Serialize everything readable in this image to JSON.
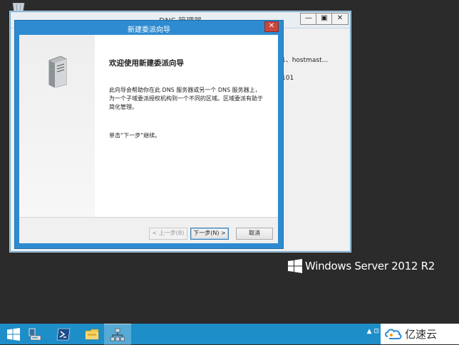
{
  "background_window": {
    "title": "DNS 管理器",
    "controls": [
      "—",
      "▣",
      "✕"
    ],
    "partial_text": [
      "1、hostmast...",
      "101"
    ]
  },
  "wizard": {
    "title": "新建委派向导",
    "close_glyph": "✕",
    "heading": "欢迎使用新建委派向导",
    "description_lines": [
      "此向导会帮助你在此 DNS 服务器或另一个 DNS 服务器上，",
      "为一个子域委派授权机构到一个不同的区域。区域委派有助于",
      "简化管理。"
    ],
    "click_instruction": "单击“下一步”继续。",
    "buttons": {
      "back": "< 上一步(B)",
      "next": "下一步(N) >",
      "cancel": "取消"
    }
  },
  "desktop": {
    "brand": "Windows Server 2012 R2"
  },
  "taskbar": {
    "items": [
      "start-icon",
      "server-manager-icon",
      "powershell-icon",
      "file-explorer-icon",
      "dns-manager-icon"
    ],
    "tray": "▲ ⊡"
  },
  "watermark": {
    "text": "亿速云"
  },
  "colors": {
    "wizard_accent": "#2e8bd1",
    "taskbar": "#1e8ec9",
    "desktop": "#2b2b2b"
  }
}
